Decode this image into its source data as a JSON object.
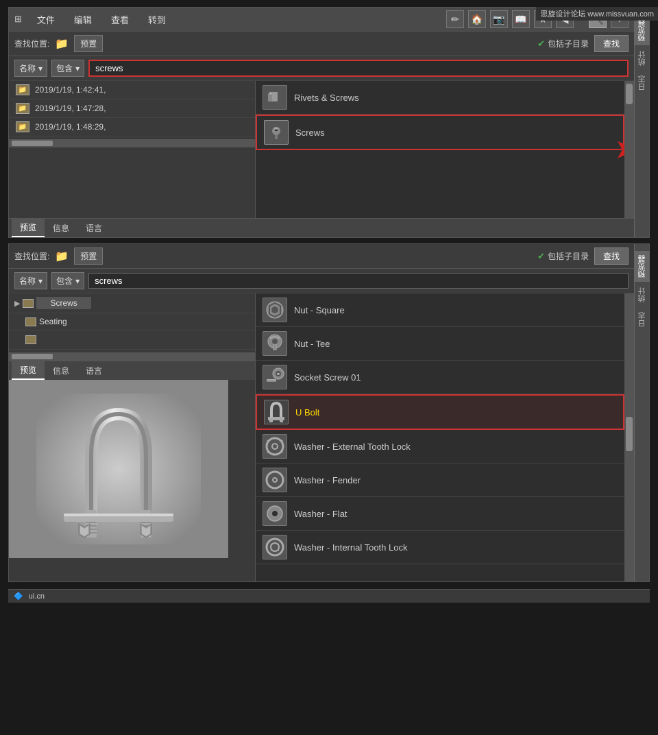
{
  "watermark": "思旋设计论坛 www.missvuan.com",
  "top_panel": {
    "toolbar": {
      "icon_label": "⊞",
      "menu_items": [
        "文件",
        "编辑",
        "查看",
        "转到"
      ],
      "right_icons": [
        "✏",
        "🏠",
        "📷",
        "📖",
        "★",
        "◀"
      ],
      "search_icon": "🔍",
      "plus_icon": "+"
    },
    "search_bar": {
      "label": "查找位置:",
      "location": "预置",
      "include_subdir": "包括子目录",
      "find_btn": "查找"
    },
    "filter_row": {
      "field1": "名称",
      "field2": "包含",
      "search_value": "screws"
    },
    "results": [
      {
        "name": "Rivets & Screws",
        "icon": "📁"
      },
      {
        "name": "Screws",
        "icon": "📁",
        "highlighted": true
      }
    ],
    "tree_items": [
      {
        "date": "2019/1/19, 1:42:41,"
      },
      {
        "date": "2019/1/19, 1:47:28,"
      },
      {
        "date": "2019/1/19, 1:48:29,"
      }
    ],
    "tabs": [
      "预览",
      "信息",
      "语言"
    ]
  },
  "bottom_panel": {
    "search_bar": {
      "label": "查找位置:",
      "location": "预置",
      "include_subdir": "包括子目录",
      "find_btn": "查找"
    },
    "filter_row": {
      "field1": "名称",
      "field2": "包含",
      "search_value": "screws"
    },
    "tree_items": [
      {
        "name": "Screws",
        "level": 1
      },
      {
        "name": "Seating",
        "level": 1
      },
      {
        "name": "",
        "level": 1
      }
    ],
    "results": [
      {
        "name": "Nut - Square",
        "icon": "⬡"
      },
      {
        "name": "Nut - Tee",
        "icon": "⚙"
      },
      {
        "name": "Socket Screw 01",
        "icon": "🔩"
      },
      {
        "name": "U Bolt",
        "icon": "⊂",
        "highlighted": true
      },
      {
        "name": "Washer - External Tooth Lock",
        "icon": "⊗"
      },
      {
        "name": "Washer - Fender",
        "icon": "○"
      },
      {
        "name": "Washer - Flat",
        "icon": "◎"
      },
      {
        "name": "Washer - Internal Tooth Lock",
        "icon": "⊕"
      }
    ],
    "tabs": [
      "预览",
      "信息",
      "语言"
    ],
    "preview_alt": "U Bolt preview image",
    "side_tabs": [
      "预览器",
      "统计",
      "日志"
    ]
  }
}
